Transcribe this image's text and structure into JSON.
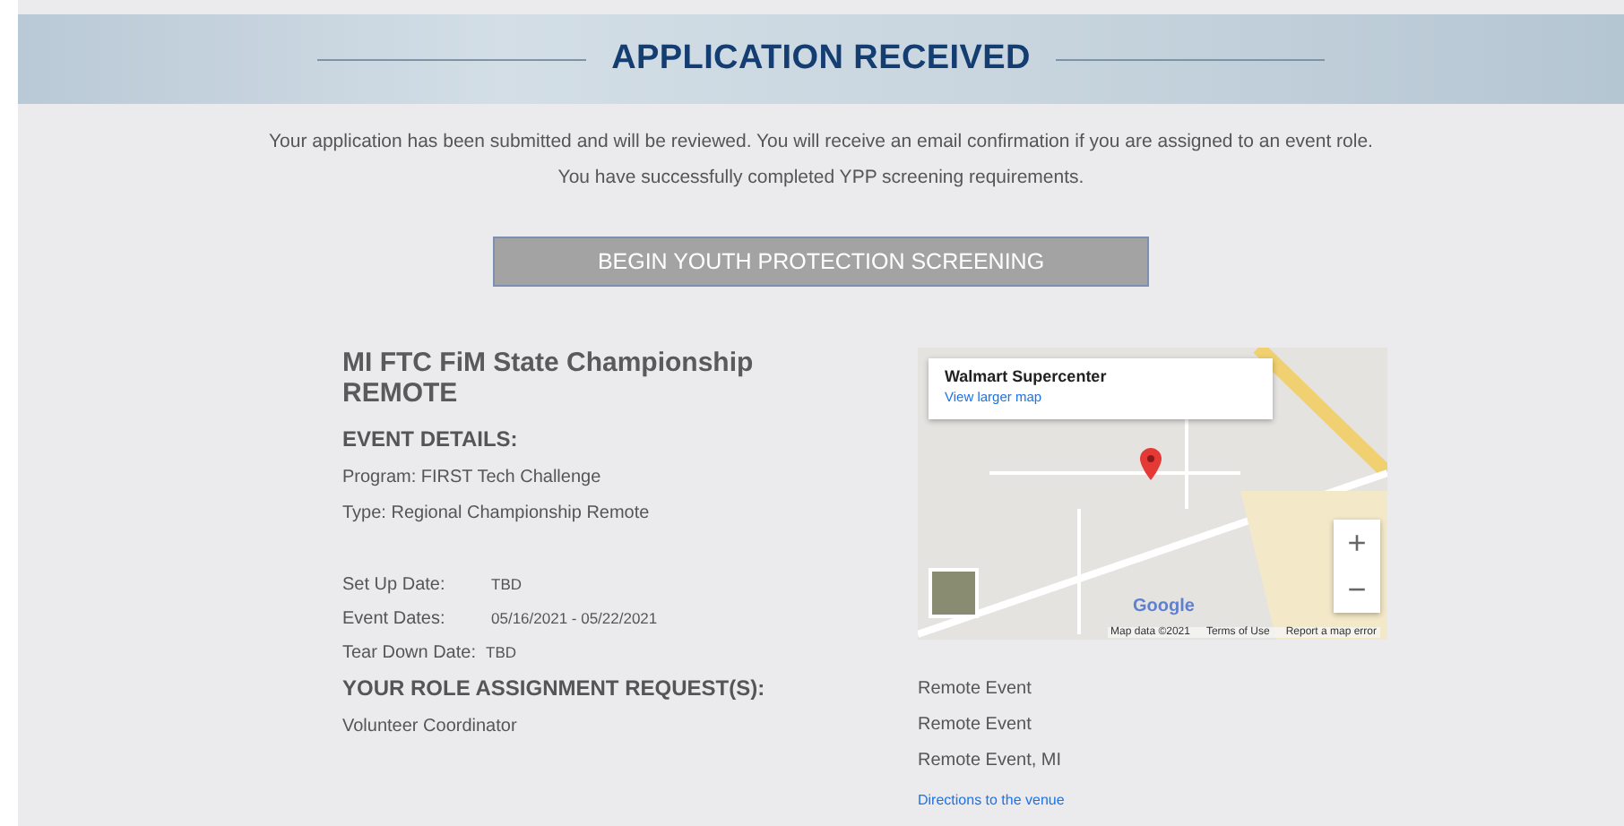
{
  "header": {
    "title": "APPLICATION RECEIVED"
  },
  "messages": [
    "Your application has been submitted and will be reviewed. You will receive an email confirmation if you are assigned to an event role.",
    "You have successfully completed YPP screening requirements."
  ],
  "screening_button": {
    "label": "BEGIN YOUTH PROTECTION SCREENING"
  },
  "event": {
    "title": "MI FTC FiM State Championship REMOTE",
    "details_heading": "EVENT DETAILS:",
    "program": "Program: FIRST Tech Challenge",
    "type": "Type: Regional Championship Remote",
    "dates": [
      {
        "label": "Set Up Date:",
        "value": "TBD"
      },
      {
        "label": "Event Dates:",
        "value": "05/16/2021 - 05/22/2021"
      },
      {
        "label": "Tear Down Date:",
        "value": "TBD"
      }
    ],
    "roles_heading": "YOUR ROLE ASSIGNMENT REQUEST(S):",
    "roles": [
      "Volunteer Coordinator"
    ]
  },
  "map": {
    "place": "Walmart Supercenter",
    "larger_link": "View larger map",
    "zoom_in": "+",
    "zoom_out": "−",
    "google": "Google",
    "footer": [
      "Map data ©2021",
      "Terms of Use",
      "Report a map error"
    ]
  },
  "venue": {
    "lines": [
      "Remote Event",
      "Remote Event",
      "Remote Event, MI"
    ],
    "directions": "Directions to the venue"
  }
}
